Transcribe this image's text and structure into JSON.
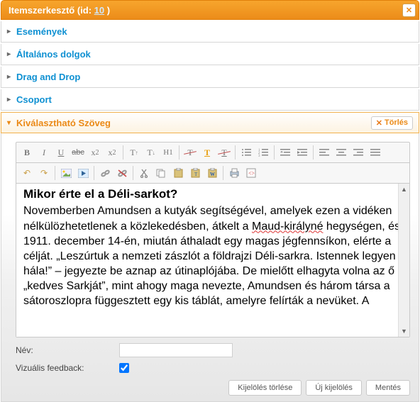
{
  "dialog": {
    "title_prefix": "Itemszerkesztő (id: ",
    "id": "10",
    "title_suffix": " )"
  },
  "sections": {
    "events": "Események",
    "general": "Általános dolgok",
    "dnd": "Drag and Drop",
    "group": "Csoport",
    "selectable": "Kiválasztható Szöveg",
    "delete_label": "Törlés"
  },
  "editor": {
    "heading": "Mikor érte el a Déli-sarkot?",
    "body": "Novemberben Amundsen a kutyák segítségével, amelyek ezen a vidéken nélkülözhetetlenek a közlekedésben, átkelt a Maud-királyné hegységen, és 1911. december 14-én, miután áthaladt egy magas jégfennsíkon, elérte a célját. „Leszúrtuk a nemzeti zászlót a földrajzi Déli-sarkra. Istennek legyen hála!” – jegyezte be aznap az útinaplójába. De mielőtt elhagyta volna az ő „kedves Sarkját”, mint ahogy maga nevezte, Amundsen és három társa a sátoroszlopra függesztett egy kis táblát, amelyre felírták a nevüket. A"
  },
  "form": {
    "name_label": "Név:",
    "name_value": "",
    "visual_label": "Vizuális feedback:",
    "visual_checked": true
  },
  "buttons": {
    "clear_sel": "Kijelölés törlése",
    "new_sel": "Új kijelölés",
    "save": "Mentés"
  }
}
